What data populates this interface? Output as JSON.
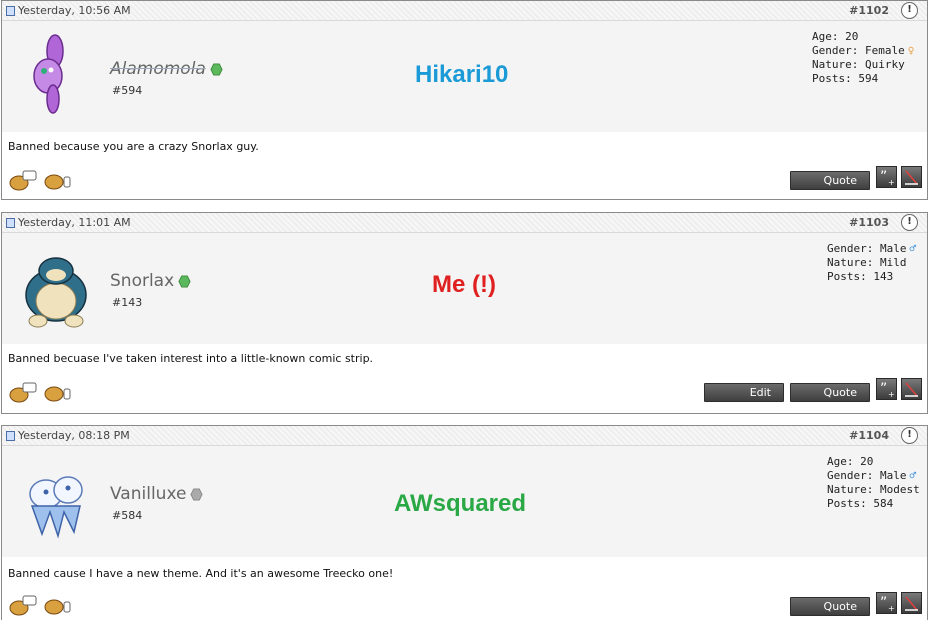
{
  "posts": [
    {
      "date": "Yesterday, 10:56 AM",
      "number": "#1102",
      "username": "Alamomola",
      "user_postnum": "#594",
      "online": true,
      "overlay": "Hikari10",
      "overlay_color": "#1a9ad6",
      "stats": [
        "Age: 20",
        "Gender: Female",
        "Nature: Quirky",
        "Posts: 594"
      ],
      "gender_symbol": "♀",
      "gender_color": "#e8a040",
      "message": "Banned because you are a crazy Snorlax guy.",
      "quote_label": "Quote"
    },
    {
      "date": "Yesterday, 11:01 AM",
      "number": "#1103",
      "username": "Snorlax",
      "user_postnum": "#143",
      "online": true,
      "overlay": "Me (!)",
      "overlay_color": "#e02020",
      "stats": [
        "Gender: Male",
        "Nature: Mild",
        "Posts: 143"
      ],
      "gender_symbol": "♂",
      "gender_color": "#3a8fe0",
      "message": "Banned becuase I've taken interest into a little-known comic strip.",
      "edit_label": "Edit",
      "quote_label": "Quote"
    },
    {
      "date": "Yesterday, 08:18 PM",
      "number": "#1104",
      "username": "Vanilluxe",
      "user_postnum": "#584",
      "online": false,
      "overlay": "AWsquared",
      "overlay_color": "#2aa845",
      "stats": [
        "Age: 20",
        "Gender: Male",
        "Nature: Modest",
        "Posts: 584"
      ],
      "gender_symbol": "♂",
      "gender_color": "#3a8fe0",
      "message": "Banned cause I have a new theme. And it's an awesome Treecko one!",
      "quote_label": "Quote"
    }
  ],
  "colors": {
    "online": "#5cb85c",
    "offline": "#aaaaaa"
  }
}
